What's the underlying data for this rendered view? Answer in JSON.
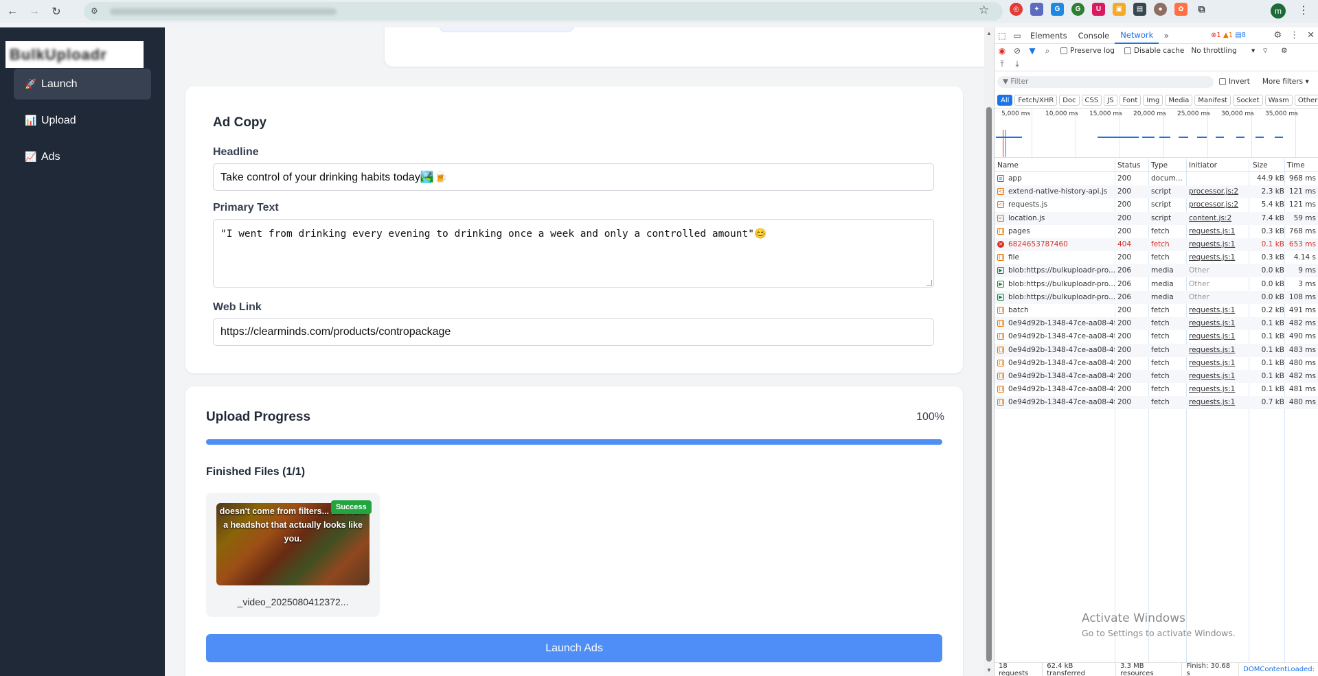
{
  "app": {
    "logo_text": "BulkUploadr"
  },
  "sidebar": {
    "items": [
      {
        "emoji": "🚀",
        "label": "Launch"
      },
      {
        "emoji": "📊",
        "label": "Upload"
      },
      {
        "emoji": "📈",
        "label": "Ads"
      }
    ]
  },
  "ad_copy": {
    "title": "Ad Copy",
    "headline_label": "Headline",
    "headline_value": "Take control of your drinking habits today🏞️🍺",
    "primary_text_label": "Primary Text",
    "primary_text_value": "\"I went from drinking every evening to drinking once a week and only a controlled amount\"😊",
    "web_link_label": "Web Link",
    "web_link_value": "https://clearminds.com/products/contropackage"
  },
  "progress": {
    "title": "Upload Progress",
    "percent_label": "100%",
    "percent_value": 100,
    "finished_label": "Finished Files (1/1)",
    "file": {
      "caption": "doesn't come from filters... but from a headshot that actually looks like you.",
      "badge": "Success",
      "name": "_video_2025080412372..."
    },
    "launch_label": "Launch Ads"
  },
  "devtools": {
    "tabs": [
      "Elements",
      "Console",
      "Network"
    ],
    "active_tab": "Network",
    "issues": {
      "errors": "1",
      "warnings": "1",
      "info": "8"
    },
    "preserve_log": "Preserve log",
    "disable_cache": "Disable cache",
    "throttling": "No throttling",
    "filter_placeholder": "Filter",
    "invert": "Invert",
    "more_filters": "More filters",
    "types": [
      "All",
      "Fetch/XHR",
      "Doc",
      "CSS",
      "JS",
      "Font",
      "Img",
      "Media",
      "Manifest",
      "Socket",
      "Wasm",
      "Other"
    ],
    "timeline_ticks": [
      "5,000 ms",
      "10,000 ms",
      "15,000 ms",
      "20,000 ms",
      "25,000 ms",
      "30,000 ms",
      "35,000 ms"
    ],
    "columns": [
      "Name",
      "Status",
      "Type",
      "Initiator",
      "Size",
      "Time"
    ],
    "requests": [
      {
        "name": "app",
        "status": "200",
        "type": "docum...",
        "initiator": "",
        "size": "44.9 kB",
        "time": "968 ms",
        "kind": "doc"
      },
      {
        "name": "extend-native-history-api.js",
        "status": "200",
        "type": "script",
        "initiator": "processor.js:2",
        "size": "2.3 kB",
        "time": "121 ms",
        "kind": "script"
      },
      {
        "name": "requests.js",
        "status": "200",
        "type": "script",
        "initiator": "processor.js:2",
        "size": "5.4 kB",
        "time": "121 ms",
        "kind": "script"
      },
      {
        "name": "location.js",
        "status": "200",
        "type": "script",
        "initiator": "content.js:2",
        "size": "7.4 kB",
        "time": "59 ms",
        "kind": "script"
      },
      {
        "name": "pages",
        "status": "200",
        "type": "fetch",
        "initiator": "requests.js:1",
        "size": "0.3 kB",
        "time": "768 ms",
        "kind": "fetch"
      },
      {
        "name": "6824653787460",
        "status": "404",
        "type": "fetch",
        "initiator": "requests.js:1",
        "size": "0.1 kB",
        "time": "653 ms",
        "kind": "error"
      },
      {
        "name": "file",
        "status": "200",
        "type": "fetch",
        "initiator": "requests.js:1",
        "size": "0.3 kB",
        "time": "4.14 s",
        "kind": "fetch"
      },
      {
        "name": "blob:https://bulkuploadr-pro...",
        "status": "206",
        "type": "media",
        "initiator": "Other",
        "size": "0.0 kB",
        "time": "9 ms",
        "kind": "media"
      },
      {
        "name": "blob:https://bulkuploadr-pro...",
        "status": "206",
        "type": "media",
        "initiator": "Other",
        "size": "0.0 kB",
        "time": "3 ms",
        "kind": "media"
      },
      {
        "name": "blob:https://bulkuploadr-pro...",
        "status": "206",
        "type": "media",
        "initiator": "Other",
        "size": "0.0 kB",
        "time": "108 ms",
        "kind": "media"
      },
      {
        "name": "batch",
        "status": "200",
        "type": "fetch",
        "initiator": "requests.js:1",
        "size": "0.2 kB",
        "time": "491 ms",
        "kind": "fetch"
      },
      {
        "name": "0e94d92b-1348-47ce-aa08-4f...",
        "status": "200",
        "type": "fetch",
        "initiator": "requests.js:1",
        "size": "0.1 kB",
        "time": "482 ms",
        "kind": "fetch"
      },
      {
        "name": "0e94d92b-1348-47ce-aa08-4f...",
        "status": "200",
        "type": "fetch",
        "initiator": "requests.js:1",
        "size": "0.1 kB",
        "time": "490 ms",
        "kind": "fetch"
      },
      {
        "name": "0e94d92b-1348-47ce-aa08-4f...",
        "status": "200",
        "type": "fetch",
        "initiator": "requests.js:1",
        "size": "0.1 kB",
        "time": "483 ms",
        "kind": "fetch"
      },
      {
        "name": "0e94d92b-1348-47ce-aa08-4f...",
        "status": "200",
        "type": "fetch",
        "initiator": "requests.js:1",
        "size": "0.1 kB",
        "time": "480 ms",
        "kind": "fetch"
      },
      {
        "name": "0e94d92b-1348-47ce-aa08-4f...",
        "status": "200",
        "type": "fetch",
        "initiator": "requests.js:1",
        "size": "0.1 kB",
        "time": "482 ms",
        "kind": "fetch"
      },
      {
        "name": "0e94d92b-1348-47ce-aa08-4f...",
        "status": "200",
        "type": "fetch",
        "initiator": "requests.js:1",
        "size": "0.1 kB",
        "time": "481 ms",
        "kind": "fetch"
      },
      {
        "name": "0e94d92b-1348-47ce-aa08-4f...",
        "status": "200",
        "type": "fetch",
        "initiator": "requests.js:1",
        "size": "0.7 kB",
        "time": "480 ms",
        "kind": "fetch"
      }
    ],
    "status_bar": {
      "requests": "18 requests",
      "transferred": "62.4 kB transferred",
      "resources": "3.3 MB resources",
      "finish": "Finish: 30.68 s",
      "dom": "DOMContentLoaded:"
    }
  },
  "watermark": {
    "line1": "Activate Windows",
    "line2": "Go to Settings to activate Windows."
  },
  "colors": {
    "sidebar_bg": "#1f2937",
    "accent": "#4f8ef7",
    "success": "#22a53f",
    "devtools_link": "#1a73e8",
    "error": "#d93025"
  }
}
